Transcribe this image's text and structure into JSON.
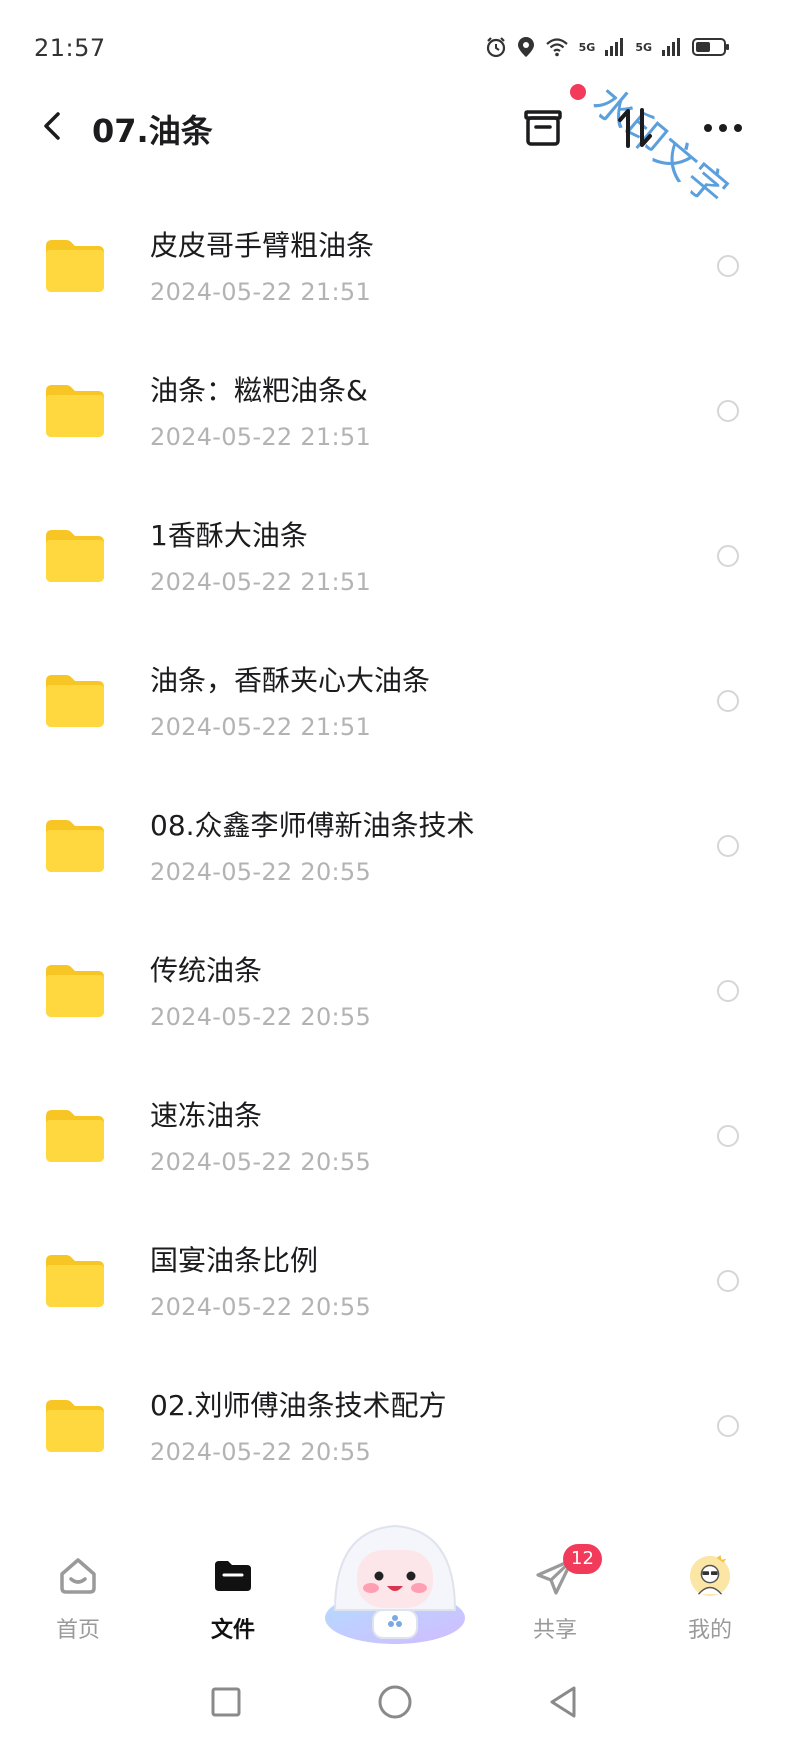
{
  "status_bar": {
    "time": "21:57",
    "network_1": "5G",
    "network_2": "5G",
    "watermark": "水印文字"
  },
  "header": {
    "title": "07.油条",
    "back_icon": "chevron-left-icon",
    "actions": [
      "archive-icon",
      "sort-icon",
      "more-icon"
    ],
    "notify_color": "#f23a5b"
  },
  "files": [
    {
      "name": "",
      "date": "2024-05-22  21:51"
    },
    {
      "name": "皮皮哥手臂粗油条",
      "date": "2024-05-22  21:51"
    },
    {
      "name": "油条：糍粑油条&",
      "date": "2024-05-22  21:51"
    },
    {
      "name": "1香酥大油条",
      "date": "2024-05-22  21:51"
    },
    {
      "name": "油条，香酥夹心大油条",
      "date": "2024-05-22  21:51"
    },
    {
      "name": "08.众鑫李师傅新油条技术",
      "date": "2024-05-22  20:55"
    },
    {
      "name": "传统油条",
      "date": "2024-05-22  20:55"
    },
    {
      "name": "速冻油条",
      "date": "2024-05-22  20:55"
    },
    {
      "name": "国宴油条比例",
      "date": "2024-05-22  20:55"
    },
    {
      "name": "02.刘师傅油条技术配方",
      "date": "2024-05-22  20:55"
    }
  ],
  "tab_bar": {
    "home": {
      "label": "首页",
      "icon": "home-icon"
    },
    "files": {
      "label": "文件",
      "icon": "folder-icon"
    },
    "share": {
      "label": "共享",
      "icon": "paper-plane-icon",
      "badge": "12"
    },
    "mine": {
      "label": "我的",
      "icon": "avatar"
    }
  },
  "colors": {
    "folder": "#ffd23a",
    "accent_red": "#f23a5b",
    "date_gray": "#b3b3b3"
  }
}
